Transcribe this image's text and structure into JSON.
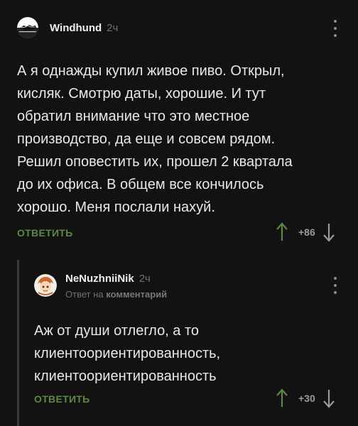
{
  "comments": [
    {
      "username": "Windhund",
      "time": "2ч",
      "text": "А я однажды купил живое пиво. Открыл,\nкисляк. Смотрю даты, хорошие. И тут\nобратил внимание что это местное\nпроизводство, да еще и совсем рядом.\nРешил оповестить их, прошел 2 квартала\nдо их офиса. В общем все кончилось\nхорошо. Меня послали нахуй.",
      "reply_label": "ОТВЕТИТЬ",
      "score": "+86",
      "avatar_icon": "wolf-logo-icon"
    },
    {
      "username": "NeNuzhniiNik",
      "time": "2ч",
      "reply_to_prefix": "Ответ на",
      "reply_to_target": "комментарий",
      "text": "Аж от души отлегло, а то\nклиентоориентированность,\nклиентоориентированность",
      "reply_label": "ОТВЕТИТЬ",
      "score": "+30",
      "avatar_icon": "anime-avatar-icon"
    }
  ],
  "colors": {
    "background": "#121212",
    "accent": "#5a8a3c",
    "text": "#e8e8e8",
    "muted": "#6f6f6f"
  }
}
